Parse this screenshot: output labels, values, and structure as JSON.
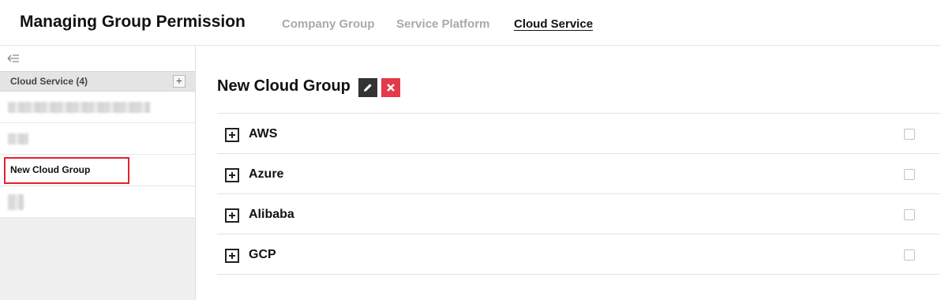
{
  "header": {
    "title": "Managing Group Permission",
    "tabs": [
      {
        "label": "Company Group",
        "active": false
      },
      {
        "label": "Service Platform",
        "active": false
      },
      {
        "label": "Cloud Service",
        "active": true
      }
    ]
  },
  "sidebar": {
    "collapse_icon": "collapse-left-icon",
    "section_label": "Cloud Service (4)",
    "add_icon": "plus-icon",
    "add_label": "+",
    "items": [
      {
        "label": "",
        "redacted": true
      },
      {
        "label": "",
        "redacted": true
      },
      {
        "label": "New Cloud Group",
        "selected": true,
        "redacted": false
      },
      {
        "label": "",
        "redacted": true
      }
    ]
  },
  "main": {
    "group_title": "New Cloud Group",
    "edit_icon": "pencil-icon",
    "delete_icon": "close-icon",
    "providers": [
      {
        "name": "AWS",
        "checked": false
      },
      {
        "name": "Azure",
        "checked": false
      },
      {
        "name": "Alibaba",
        "checked": false
      },
      {
        "name": "GCP",
        "checked": false
      }
    ]
  },
  "colors": {
    "highlight": "#e5202a",
    "delete_button": "#e23a48",
    "edit_button": "#333333",
    "inactive_tab": "#a9a9a9"
  }
}
